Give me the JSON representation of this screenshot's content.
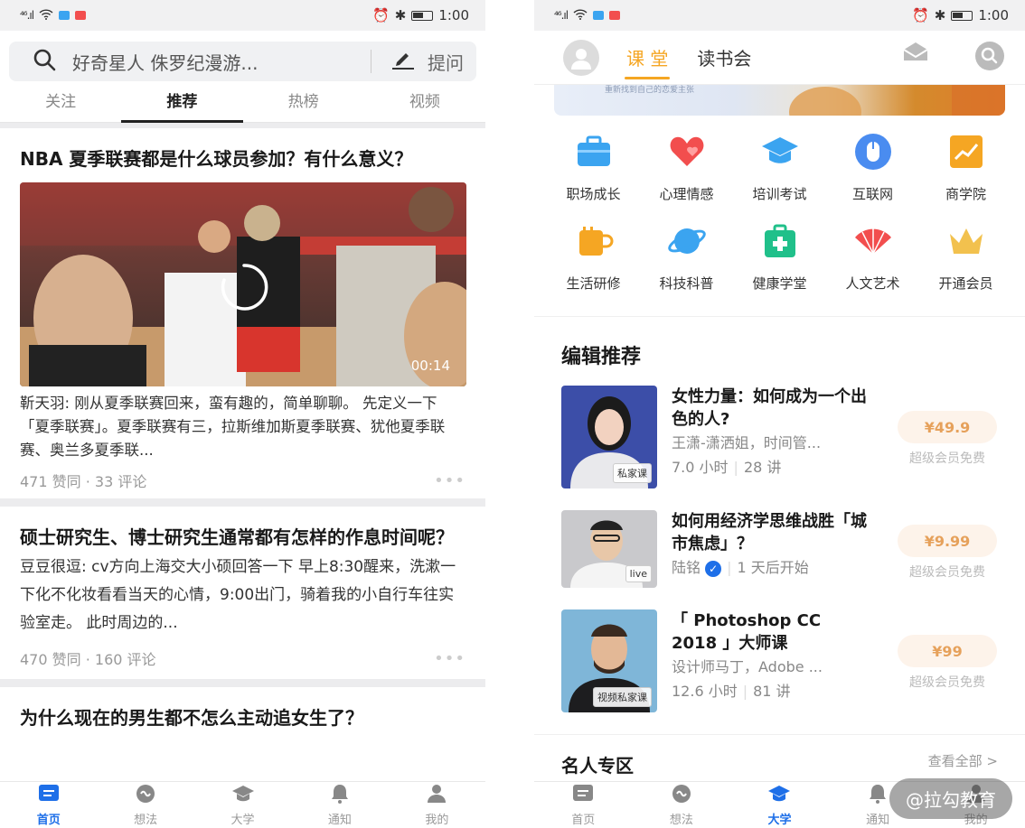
{
  "left": {
    "status": {
      "time": "1:00",
      "signal": "⁴⁶.ıl"
    },
    "search": {
      "query": "好奇星人 侏罗纪漫游...",
      "ask_label": "提问"
    },
    "tabs": [
      {
        "label": "关注"
      },
      {
        "label": "推荐"
      },
      {
        "label": "热榜"
      },
      {
        "label": "视频"
      }
    ],
    "feed": [
      {
        "title": "NBA 夏季联赛都是什么球员参加？有什么意义？",
        "video_duration": "00:14",
        "excerpt": "靳天羽: 刚从夏季联赛回来，蛮有趣的，简单聊聊。 先定义一下「夏季联赛」。夏季联赛有三，拉斯维加斯夏季联赛、犹他夏季联赛、奥兰多夏季联...",
        "stats": "471 赞同 · 33 评论"
      },
      {
        "title": "硕士研究生、博士研究生通常都有怎样的作息时间呢？",
        "excerpt": "豆豆很逗: cv方向上海交大小硕回答一下 早上8:30醒来，洗漱一下化不化妆看看当天的心情，9:00出门，骑着我的小自行车往实验室走。 此时周边的...",
        "stats": "470 赞同 · 160 评论"
      },
      {
        "title": "为什么现在的男生都不怎么主动追女生了？"
      }
    ],
    "bottom_nav": [
      {
        "label": "首页",
        "icon": "home-icon"
      },
      {
        "label": "想法",
        "icon": "idea-icon"
      },
      {
        "label": "大学",
        "icon": "graduation-cap-icon"
      },
      {
        "label": "通知",
        "icon": "bell-icon"
      },
      {
        "label": "我的",
        "icon": "person-icon"
      }
    ]
  },
  "right": {
    "status": {
      "time": "1:00",
      "signal": "⁴⁶.ıl"
    },
    "header": {
      "tabs": [
        {
          "label": "课 堂"
        },
        {
          "label": "读书会"
        }
      ]
    },
    "banner_text": "重新找到自己的恋爱主张",
    "categories": [
      {
        "label": "职场成长",
        "icon": "briefcase-icon",
        "color": "#3ba4f0"
      },
      {
        "label": "心理情感",
        "icon": "heart-icon",
        "color": "#f24e4e"
      },
      {
        "label": "培训考试",
        "icon": "graduation-cap-icon",
        "color": "#3ba4f0"
      },
      {
        "label": "互联网",
        "icon": "mouse-icon",
        "color": "#4a8cf0"
      },
      {
        "label": "商学院",
        "icon": "chart-icon",
        "color": "#f5a623"
      },
      {
        "label": "生活研修",
        "icon": "cup-icon",
        "color": "#f5a623"
      },
      {
        "label": "科技科普",
        "icon": "planet-icon",
        "color": "#3ba4f0"
      },
      {
        "label": "健康学堂",
        "icon": "medkit-icon",
        "color": "#20c08a"
      },
      {
        "label": "人文艺术",
        "icon": "fan-icon",
        "color": "#f24e4e"
      },
      {
        "label": "开通会员",
        "icon": "crown-icon",
        "color": "#f2c14e"
      }
    ],
    "editor_title": "编辑推荐",
    "courses": [
      {
        "title": "女性力量：如何成为一个出色的人?",
        "subtitle": "王潇-潇洒姐，时间管...",
        "meta1": "7.0 小时",
        "meta2": "28 讲",
        "badge": "私家课",
        "price": "¥49.9",
        "free": "超级会员免费"
      },
      {
        "title": "如何用经济学思维战胜「城市焦虑」？",
        "subtitle": "陆铭",
        "meta1": "1 天后开始",
        "badge": "live",
        "price": "¥9.99",
        "free": "超级会员免费"
      },
      {
        "title": "「 Photoshop CC 2018 」大师课",
        "subtitle": "设计师马丁，Adobe ...",
        "meta1": "12.6 小时",
        "meta2": "81 讲",
        "badge": "视频私家课",
        "price": "¥99",
        "free": "超级会员免费"
      }
    ],
    "famous": {
      "title": "名人专区",
      "more": "查看全部 >"
    },
    "bottom_nav": [
      {
        "label": "首页",
        "icon": "home-icon"
      },
      {
        "label": "想法",
        "icon": "idea-icon"
      },
      {
        "label": "大学",
        "icon": "graduation-cap-icon"
      },
      {
        "label": "通知",
        "icon": "bell-icon"
      },
      {
        "label": "我的",
        "icon": "person-icon"
      }
    ],
    "watermark": "@拉勾教育"
  }
}
